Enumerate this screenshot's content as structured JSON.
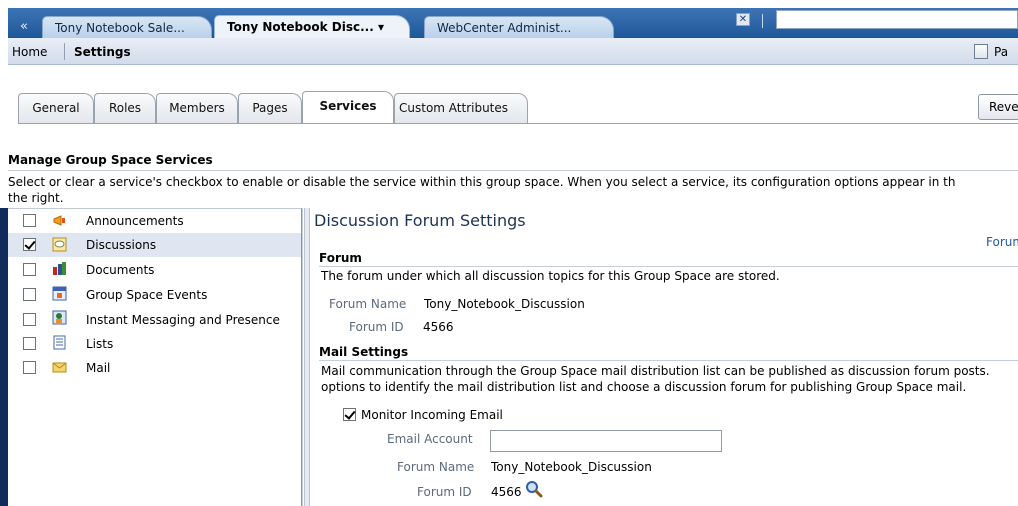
{
  "tabs": {
    "collapse": "«",
    "items": [
      {
        "label": "Tony Notebook Sale..."
      },
      {
        "label": "Tony Notebook Disc... ▾"
      },
      {
        "label": "WebCenter Administ..."
      }
    ],
    "search_value": ""
  },
  "breadcrumb": {
    "home": "Home",
    "current": "Settings"
  },
  "page_link": "Pa",
  "settings_tabs": [
    "General",
    "Roles",
    "Members",
    "Pages",
    "Services",
    "Custom Attributes"
  ],
  "revert_button": "Reve",
  "manage": {
    "heading": "Manage Group Space Services",
    "description_line1": "Select or clear a service's checkbox to enable or disable the service within this group space. When you select a service, its configuration options appear in th",
    "description_line2": "the right."
  },
  "services": [
    {
      "label": "Announcements",
      "checked": false
    },
    {
      "label": "Discussions",
      "checked": true
    },
    {
      "label": "Documents",
      "checked": false
    },
    {
      "label": "Group Space Events",
      "checked": false
    },
    {
      "label": "Instant Messaging and Presence",
      "checked": false
    },
    {
      "label": "Lists",
      "checked": false
    },
    {
      "label": "Mail",
      "checked": false
    }
  ],
  "panel": {
    "title": "Discussion Forum Settings",
    "forum_link": "Forum A",
    "forum_heading": "Forum",
    "forum_desc": "The forum under which all discussion topics for this Group Space are stored.",
    "forum_name_label": "Forum Name",
    "forum_name_value": "Tony_Notebook_Discussion",
    "forum_id_label": "Forum ID",
    "forum_id_value": "4566",
    "mail_heading": "Mail Settings",
    "mail_desc_line1": "Mail communication through the Group Space mail distribution list can be published as discussion forum posts.",
    "mail_desc_line2": "options to identify the mail distribution list and choose a discussion forum for publishing Group Space mail.",
    "monitor_label": "Monitor Incoming Email",
    "email_account_label": "Email Account",
    "email_account_value": "",
    "mail_forum_name_label": "Forum Name",
    "mail_forum_name_value": "Tony_Notebook_Discussion",
    "mail_forum_id_label": "Forum ID",
    "mail_forum_id_value": "4566"
  }
}
